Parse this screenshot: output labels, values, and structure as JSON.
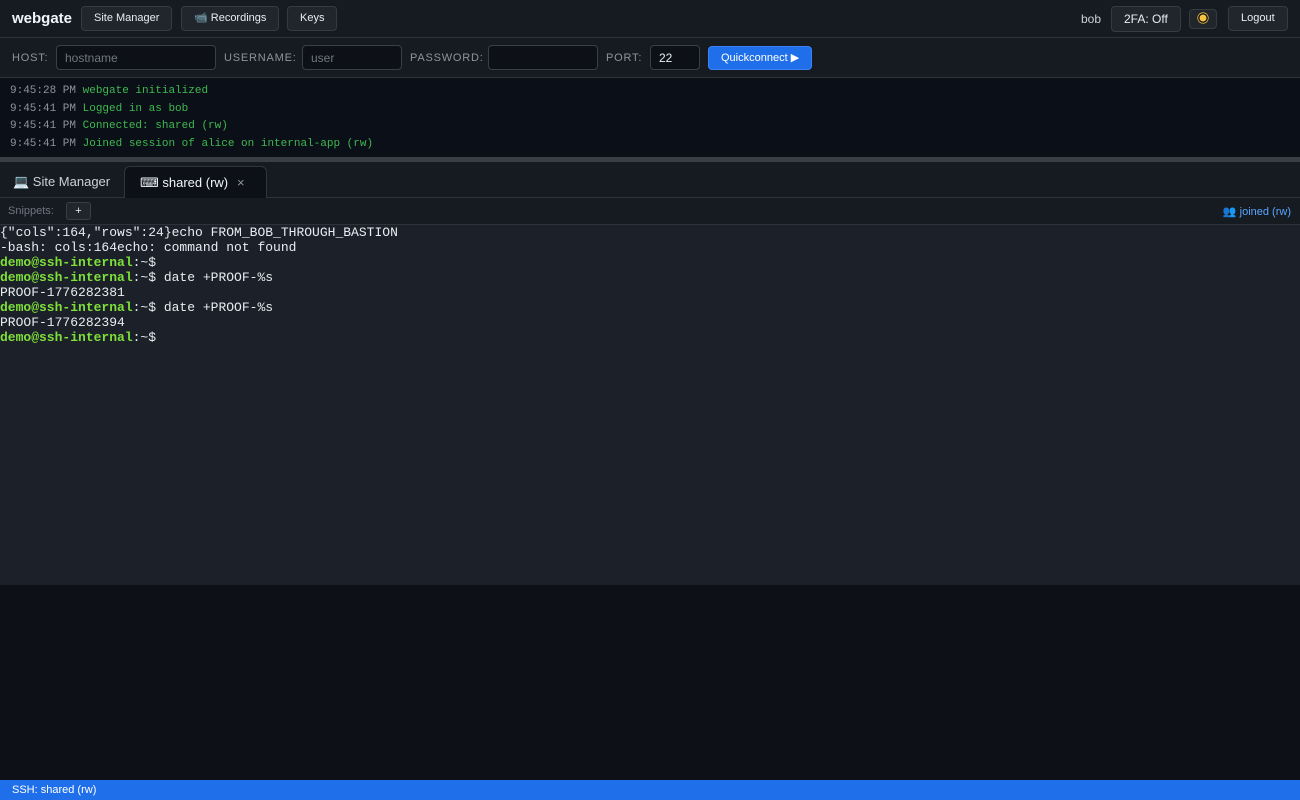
{
  "header": {
    "brand": "webgate",
    "nav": {
      "site_manager": "Site Manager",
      "recordings": "📹 Recordings",
      "keys": "Keys"
    },
    "username": "bob",
    "twofa": "2FA: Off",
    "theme_icon": "sun-icon",
    "logout": "Logout"
  },
  "quickconnect": {
    "host_label": "HOST:",
    "host_placeholder": "hostname",
    "username_label": "USERNAME:",
    "username_placeholder": "user",
    "password_label": "PASSWORD:",
    "port_label": "PORT:",
    "port_value": "22",
    "button": "Quickconnect ▶"
  },
  "log": [
    {
      "time": "9:45:28 PM",
      "msg": "webgate initialized"
    },
    {
      "time": "9:45:41 PM",
      "msg": "Logged in as bob"
    },
    {
      "time": "9:45:41 PM",
      "msg": "Connected: shared (rw)"
    },
    {
      "time": "9:45:41 PM",
      "msg": "Joined session of alice on internal-app (rw)"
    }
  ],
  "tabs": {
    "site_manager": "💻 Site Manager",
    "session": "⌨ shared (rw)",
    "close": "×"
  },
  "snippets": {
    "label": "Snippets:",
    "add": "+",
    "joined": "👥 joined (rw)"
  },
  "terminal": {
    "prompt_user": "demo@ssh-internal",
    "prompt_tail": ":~$",
    "lines": [
      "{\"cols\":164,\"rows\":24}echo FROM_BOB_THROUGH_BASTION",
      "-bash: cols:164echo: command not found"
    ],
    "commands": [
      {
        "cmd": "",
        "output": ""
      },
      {
        "cmd": " date +PROOF-%s",
        "output": "PROOF-1776282381"
      },
      {
        "cmd": " date +PROOF-%s",
        "output": "PROOF-1776282394"
      },
      {
        "cmd": "",
        "output": ""
      }
    ]
  },
  "statusbar": {
    "text": "SSH: shared (rw)"
  },
  "colors": {
    "accent": "#1f6feb",
    "prompt": "#7ee03a",
    "log_message": "#3fb950"
  }
}
